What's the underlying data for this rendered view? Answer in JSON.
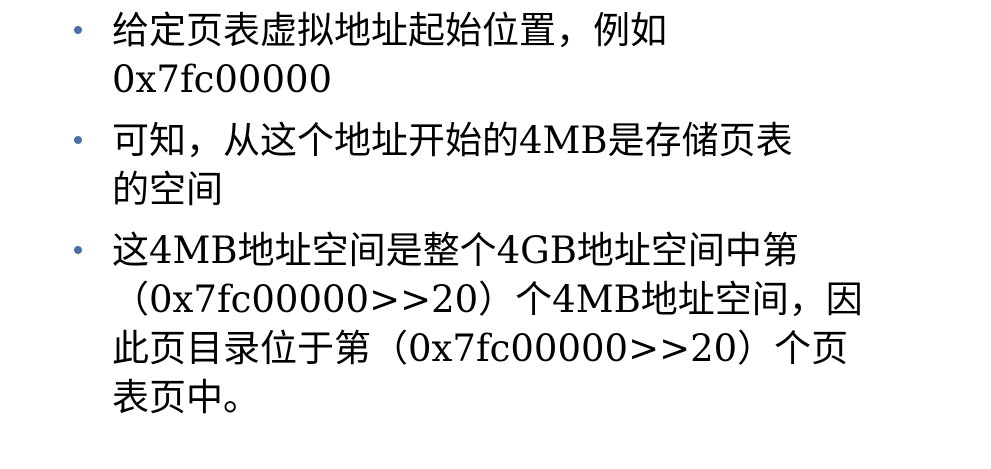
{
  "bullets": [
    {
      "lines": [
        "给定页表虚拟地址起始位置，例如",
        "0x7fc00000"
      ]
    },
    {
      "lines": [
        "可知，从这个地址开始的4MB是存储页表",
        "的空间"
      ]
    },
    {
      "lines": [
        "这4MB地址空间是整个4GB地址空间中第",
        "（0x7fc00000>>20）个4MB地址空间，因",
        "此页目录位于第（0x7fc00000>>20）个页",
        "表页中。"
      ]
    }
  ],
  "colors": {
    "bullet": "#4a6fa5",
    "text": "#000000",
    "background": "#ffffff"
  }
}
